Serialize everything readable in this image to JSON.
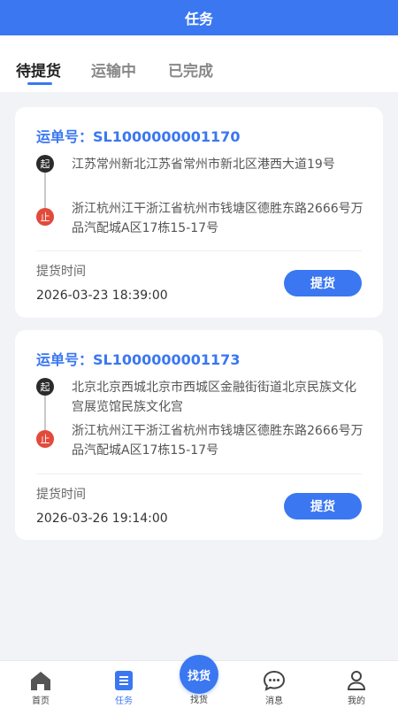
{
  "header": {
    "title": "任务"
  },
  "tabs": [
    {
      "label": "待提货",
      "active": true
    },
    {
      "label": "运输中",
      "active": false
    },
    {
      "label": "已完成",
      "active": false
    }
  ],
  "orders": [
    {
      "waybill": "运单号：SL1000000001170",
      "start_badge": "起",
      "end_badge": "止",
      "from": "江苏常州新北江苏省常州市新北区港西大道19号",
      "to": "浙江杭州江干浙江省杭州市钱塘区德胜东路2666号万品汽配城A区17栋15-17号",
      "time_label": "提货时间",
      "time": "2026-03-23 18:39:00",
      "action": "提货"
    },
    {
      "waybill": "运单号：SL1000000001173",
      "start_badge": "起",
      "end_badge": "止",
      "from": "北京北京西城北京市西城区金融街街道北京民族文化宫展览馆民族文化宫",
      "to": "浙江杭州江干浙江省杭州市钱塘区德胜东路2666号万品汽配城A区17栋15-17号",
      "time_label": "提货时间",
      "time": "2026-03-26 19:14:00",
      "action": "提货"
    }
  ],
  "tabbar": {
    "home": "首页",
    "tasks": "任务",
    "find_circle": "找货",
    "find": "找货",
    "messages": "消息",
    "mine": "我的"
  },
  "colors": {
    "accent": "#3a77f1",
    "end_badge": "#e24a3b",
    "start_badge": "#2b2b2b"
  },
  "icons": [
    "home-icon",
    "task-list-icon",
    "chat-bubble-icon",
    "user-icon"
  ]
}
